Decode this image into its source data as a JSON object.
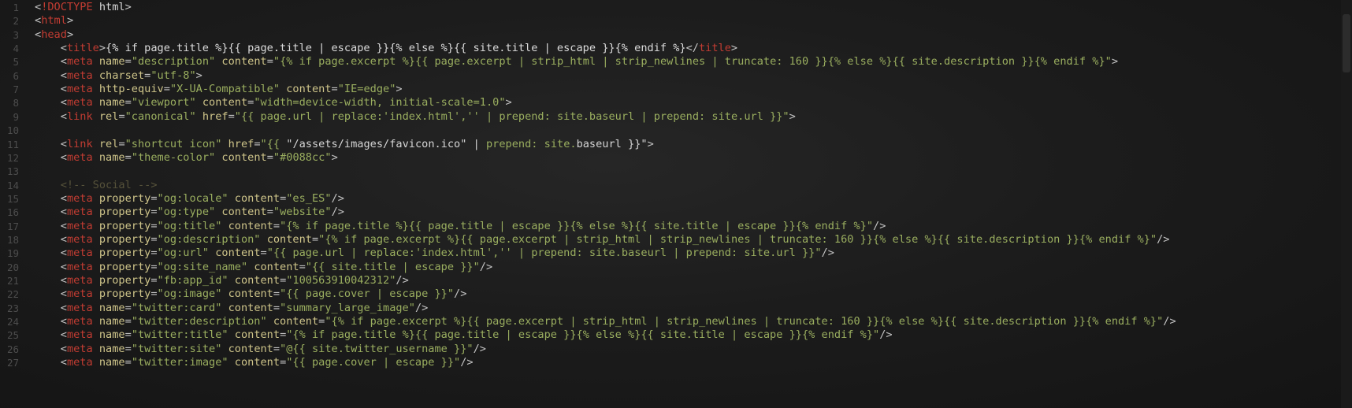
{
  "editor": {
    "lines": [
      {
        "n": "1",
        "tokens": [
          [
            "punct",
            "<"
          ],
          [
            "tag",
            "!DOCTYPE"
          ],
          [
            "text",
            " html"
          ],
          [
            "punct",
            ">"
          ]
        ]
      },
      {
        "n": "2",
        "tokens": [
          [
            "punct",
            "<"
          ],
          [
            "tag",
            "html"
          ],
          [
            "punct",
            ">"
          ]
        ]
      },
      {
        "n": "3",
        "tokens": [
          [
            "punct",
            "<"
          ],
          [
            "tag",
            "head"
          ],
          [
            "punct",
            ">"
          ]
        ]
      },
      {
        "n": "4",
        "tokens": [
          [
            "text",
            "    "
          ],
          [
            "punct",
            "<"
          ],
          [
            "tag",
            "title"
          ],
          [
            "punct",
            ">"
          ],
          [
            "liquid",
            "{% if page.title %}{{ page.title | escape }}{% else %}{{ site.title | escape }}{% endif %}"
          ],
          [
            "punct",
            "</"
          ],
          [
            "tag",
            "title"
          ],
          [
            "punct",
            ">"
          ]
        ]
      },
      {
        "n": "5",
        "tokens": [
          [
            "text",
            "    "
          ],
          [
            "punct",
            "<"
          ],
          [
            "tag",
            "meta"
          ],
          [
            "text",
            " "
          ],
          [
            "attr",
            "name"
          ],
          [
            "punct",
            "="
          ],
          [
            "str",
            "\"description\""
          ],
          [
            "text",
            " "
          ],
          [
            "attr",
            "content"
          ],
          [
            "punct",
            "="
          ],
          [
            "str",
            "\"{% if page.excerpt %}{{ page.excerpt | strip_html | strip_newlines | truncate: 160 }}{% else %}{{ site.description }}{% endif %}\""
          ],
          [
            "punct",
            ">"
          ]
        ]
      },
      {
        "n": "6",
        "tokens": [
          [
            "text",
            "    "
          ],
          [
            "punct",
            "<"
          ],
          [
            "tag",
            "meta"
          ],
          [
            "text",
            " "
          ],
          [
            "attr",
            "charset"
          ],
          [
            "punct",
            "="
          ],
          [
            "str",
            "\"utf-8\""
          ],
          [
            "punct",
            ">"
          ]
        ]
      },
      {
        "n": "7",
        "tokens": [
          [
            "text",
            "    "
          ],
          [
            "punct",
            "<"
          ],
          [
            "tag",
            "meta"
          ],
          [
            "text",
            " "
          ],
          [
            "attr",
            "http-equiv"
          ],
          [
            "punct",
            "="
          ],
          [
            "str",
            "\"X-UA-Compatible\""
          ],
          [
            "text",
            " "
          ],
          [
            "attr",
            "content"
          ],
          [
            "punct",
            "="
          ],
          [
            "str",
            "\"IE=edge\""
          ],
          [
            "punct",
            ">"
          ]
        ]
      },
      {
        "n": "8",
        "tokens": [
          [
            "text",
            "    "
          ],
          [
            "punct",
            "<"
          ],
          [
            "tag",
            "meta"
          ],
          [
            "text",
            " "
          ],
          [
            "attr",
            "name"
          ],
          [
            "punct",
            "="
          ],
          [
            "str",
            "\"viewport\""
          ],
          [
            "text",
            " "
          ],
          [
            "attr",
            "content"
          ],
          [
            "punct",
            "="
          ],
          [
            "str",
            "\"width=device-width, initial-scale=1.0\""
          ],
          [
            "punct",
            ">"
          ]
        ]
      },
      {
        "n": "9",
        "tokens": [
          [
            "text",
            "    "
          ],
          [
            "punct",
            "<"
          ],
          [
            "tag",
            "link"
          ],
          [
            "text",
            " "
          ],
          [
            "attr",
            "rel"
          ],
          [
            "punct",
            "="
          ],
          [
            "str",
            "\"canonical\""
          ],
          [
            "text",
            " "
          ],
          [
            "attr",
            "href"
          ],
          [
            "punct",
            "="
          ],
          [
            "str",
            "\"{{ page.url | replace:'index.html','' | prepend: site.baseurl | prepend: site.url }}\""
          ],
          [
            "punct",
            ">"
          ]
        ]
      },
      {
        "n": "10",
        "tokens": []
      },
      {
        "n": "11",
        "tokens": [
          [
            "text",
            "    "
          ],
          [
            "punct",
            "<"
          ],
          [
            "tag",
            "link"
          ],
          [
            "text",
            " "
          ],
          [
            "attr",
            "rel"
          ],
          [
            "punct",
            "="
          ],
          [
            "str",
            "\"shortcut icon\""
          ],
          [
            "text",
            " "
          ],
          [
            "attr",
            "href"
          ],
          [
            "punct",
            "="
          ],
          [
            "str",
            "\"{{ "
          ],
          [
            "text",
            "\"/assets/images/favicon.ico\" | "
          ],
          [
            "str",
            "prepend: site."
          ],
          [
            "text",
            "baseurl }}\""
          ],
          [
            "punct",
            ">"
          ]
        ]
      },
      {
        "n": "12",
        "tokens": [
          [
            "text",
            "    "
          ],
          [
            "punct",
            "<"
          ],
          [
            "tag",
            "meta"
          ],
          [
            "text",
            " "
          ],
          [
            "attr",
            "name"
          ],
          [
            "punct",
            "="
          ],
          [
            "str",
            "\"theme-color\""
          ],
          [
            "text",
            " "
          ],
          [
            "attr",
            "content"
          ],
          [
            "punct",
            "="
          ],
          [
            "str",
            "\"#0088cc\""
          ],
          [
            "punct",
            ">"
          ]
        ]
      },
      {
        "n": "13",
        "tokens": []
      },
      {
        "n": "14",
        "tokens": [
          [
            "text",
            "    "
          ],
          [
            "comment",
            "<!-- Social -->"
          ]
        ]
      },
      {
        "n": "15",
        "tokens": [
          [
            "text",
            "    "
          ],
          [
            "punct",
            "<"
          ],
          [
            "tag",
            "meta"
          ],
          [
            "text",
            " "
          ],
          [
            "attr",
            "property"
          ],
          [
            "punct",
            "="
          ],
          [
            "str",
            "\"og:locale\""
          ],
          [
            "text",
            " "
          ],
          [
            "attr",
            "content"
          ],
          [
            "punct",
            "="
          ],
          [
            "str",
            "\"es_ES\""
          ],
          [
            "punct",
            "/>"
          ]
        ]
      },
      {
        "n": "16",
        "tokens": [
          [
            "text",
            "    "
          ],
          [
            "punct",
            "<"
          ],
          [
            "tag",
            "meta"
          ],
          [
            "text",
            " "
          ],
          [
            "attr",
            "property"
          ],
          [
            "punct",
            "="
          ],
          [
            "str",
            "\"og:type\""
          ],
          [
            "text",
            " "
          ],
          [
            "attr",
            "content"
          ],
          [
            "punct",
            "="
          ],
          [
            "str",
            "\"website\""
          ],
          [
            "punct",
            "/>"
          ]
        ]
      },
      {
        "n": "17",
        "tokens": [
          [
            "text",
            "    "
          ],
          [
            "punct",
            "<"
          ],
          [
            "tag",
            "meta"
          ],
          [
            "text",
            " "
          ],
          [
            "attr",
            "property"
          ],
          [
            "punct",
            "="
          ],
          [
            "str",
            "\"og:title\""
          ],
          [
            "text",
            " "
          ],
          [
            "attr",
            "content"
          ],
          [
            "punct",
            "="
          ],
          [
            "str",
            "\"{% if page.title %}{{ page.title | escape }}{% else %}{{ site.title | escape }}{% endif %}\""
          ],
          [
            "punct",
            "/>"
          ]
        ]
      },
      {
        "n": "18",
        "tokens": [
          [
            "text",
            "    "
          ],
          [
            "punct",
            "<"
          ],
          [
            "tag",
            "meta"
          ],
          [
            "text",
            " "
          ],
          [
            "attr",
            "property"
          ],
          [
            "punct",
            "="
          ],
          [
            "str",
            "\"og:description\""
          ],
          [
            "text",
            " "
          ],
          [
            "attr",
            "content"
          ],
          [
            "punct",
            "="
          ],
          [
            "str",
            "\"{% if page.excerpt %}{{ page.excerpt | strip_html | strip_newlines | truncate: 160 }}{% else %}{{ site.description }}{% endif %}\""
          ],
          [
            "punct",
            "/>"
          ]
        ]
      },
      {
        "n": "19",
        "tokens": [
          [
            "text",
            "    "
          ],
          [
            "punct",
            "<"
          ],
          [
            "tag",
            "meta"
          ],
          [
            "text",
            " "
          ],
          [
            "attr",
            "property"
          ],
          [
            "punct",
            "="
          ],
          [
            "str",
            "\"og:url\""
          ],
          [
            "text",
            " "
          ],
          [
            "attr",
            "content"
          ],
          [
            "punct",
            "="
          ],
          [
            "str",
            "\"{{ page.url | replace:'index.html','' | prepend: site.baseurl | prepend: site.url }}\""
          ],
          [
            "punct",
            "/>"
          ]
        ]
      },
      {
        "n": "20",
        "tokens": [
          [
            "text",
            "    "
          ],
          [
            "punct",
            "<"
          ],
          [
            "tag",
            "meta"
          ],
          [
            "text",
            " "
          ],
          [
            "attr",
            "property"
          ],
          [
            "punct",
            "="
          ],
          [
            "str",
            "\"og:site_name\""
          ],
          [
            "text",
            " "
          ],
          [
            "attr",
            "content"
          ],
          [
            "punct",
            "="
          ],
          [
            "str",
            "\"{{ site.title | escape }}\""
          ],
          [
            "punct",
            "/>"
          ]
        ]
      },
      {
        "n": "21",
        "tokens": [
          [
            "text",
            "    "
          ],
          [
            "punct",
            "<"
          ],
          [
            "tag",
            "meta"
          ],
          [
            "text",
            " "
          ],
          [
            "attr",
            "property"
          ],
          [
            "punct",
            "="
          ],
          [
            "str",
            "\"fb:app_id\""
          ],
          [
            "text",
            " "
          ],
          [
            "attr",
            "content"
          ],
          [
            "punct",
            "="
          ],
          [
            "str",
            "\"100563910042312\""
          ],
          [
            "punct",
            "/>"
          ]
        ]
      },
      {
        "n": "22",
        "tokens": [
          [
            "text",
            "    "
          ],
          [
            "punct",
            "<"
          ],
          [
            "tag",
            "meta"
          ],
          [
            "text",
            " "
          ],
          [
            "attr",
            "property"
          ],
          [
            "punct",
            "="
          ],
          [
            "str",
            "\"og:image\""
          ],
          [
            "text",
            " "
          ],
          [
            "attr",
            "content"
          ],
          [
            "punct",
            "="
          ],
          [
            "str",
            "\"{{ page.cover | escape }}\""
          ],
          [
            "punct",
            "/>"
          ]
        ]
      },
      {
        "n": "23",
        "tokens": [
          [
            "text",
            "    "
          ],
          [
            "punct",
            "<"
          ],
          [
            "tag",
            "meta"
          ],
          [
            "text",
            " "
          ],
          [
            "attr",
            "name"
          ],
          [
            "punct",
            "="
          ],
          [
            "str",
            "\"twitter:card\""
          ],
          [
            "text",
            " "
          ],
          [
            "attr",
            "content"
          ],
          [
            "punct",
            "="
          ],
          [
            "str",
            "\"summary_large_image\""
          ],
          [
            "punct",
            "/>"
          ]
        ]
      },
      {
        "n": "24",
        "tokens": [
          [
            "text",
            "    "
          ],
          [
            "punct",
            "<"
          ],
          [
            "tag",
            "meta"
          ],
          [
            "text",
            " "
          ],
          [
            "attr",
            "name"
          ],
          [
            "punct",
            "="
          ],
          [
            "str",
            "\"twitter:description\""
          ],
          [
            "text",
            " "
          ],
          [
            "attr",
            "content"
          ],
          [
            "punct",
            "="
          ],
          [
            "str",
            "\"{% if page.excerpt %}{{ page.excerpt | strip_html | strip_newlines | truncate: 160 }}{% else %}{{ site.description }}{% endif %}\""
          ],
          [
            "punct",
            "/>"
          ]
        ]
      },
      {
        "n": "25",
        "tokens": [
          [
            "text",
            "    "
          ],
          [
            "punct",
            "<"
          ],
          [
            "tag",
            "meta"
          ],
          [
            "text",
            " "
          ],
          [
            "attr",
            "name"
          ],
          [
            "punct",
            "="
          ],
          [
            "str",
            "\"twitter:title\""
          ],
          [
            "text",
            " "
          ],
          [
            "attr",
            "content"
          ],
          [
            "punct",
            "="
          ],
          [
            "str",
            "\"{% if page.title %}{{ page.title | escape }}{% else %}{{ site.title | escape }}{% endif %}\""
          ],
          [
            "punct",
            "/>"
          ]
        ]
      },
      {
        "n": "26",
        "tokens": [
          [
            "text",
            "    "
          ],
          [
            "punct",
            "<"
          ],
          [
            "tag",
            "meta"
          ],
          [
            "text",
            " "
          ],
          [
            "attr",
            "name"
          ],
          [
            "punct",
            "="
          ],
          [
            "str",
            "\"twitter:site\""
          ],
          [
            "text",
            " "
          ],
          [
            "attr",
            "content"
          ],
          [
            "punct",
            "="
          ],
          [
            "str",
            "\"@{{ site.twitter_username }}\""
          ],
          [
            "punct",
            "/>"
          ]
        ]
      },
      {
        "n": "27",
        "tokens": [
          [
            "text",
            "    "
          ],
          [
            "punct",
            "<"
          ],
          [
            "tag",
            "meta"
          ],
          [
            "text",
            " "
          ],
          [
            "attr",
            "name"
          ],
          [
            "punct",
            "="
          ],
          [
            "str",
            "\"twitter:image\""
          ],
          [
            "text",
            " "
          ],
          [
            "attr",
            "content"
          ],
          [
            "punct",
            "="
          ],
          [
            "str",
            "\"{{ page.cover | escape }}\""
          ],
          [
            "punct",
            "/>"
          ]
        ]
      }
    ]
  }
}
